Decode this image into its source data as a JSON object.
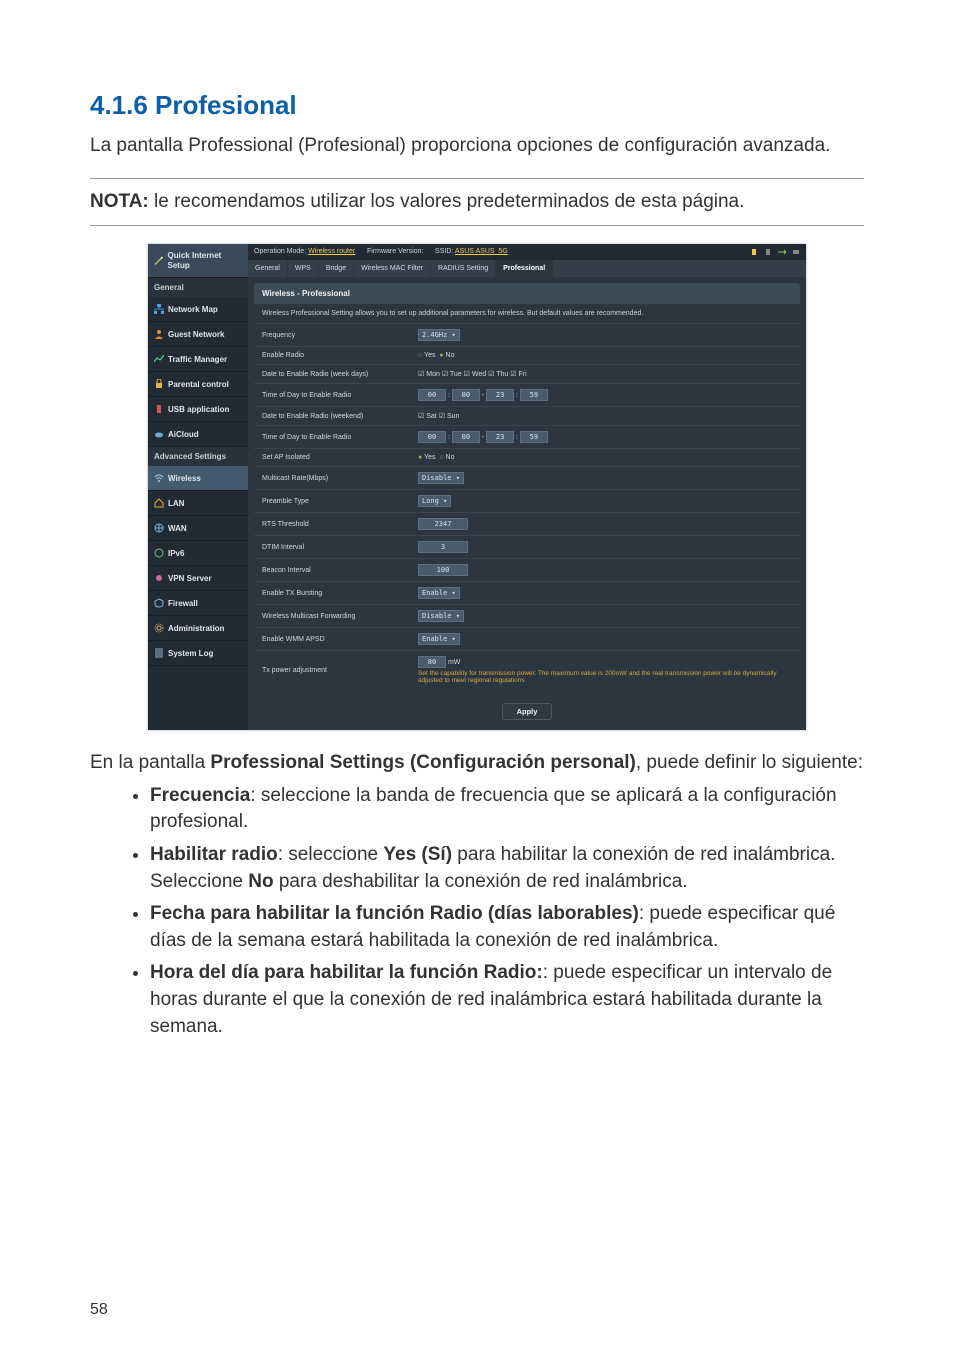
{
  "heading": "4.1.6 Profesional",
  "intro": "La pantalla Professional (Profesional) proporciona opciones de configuración avanzada.",
  "note_label": "NOTA:",
  "note_text": "  le recomendamos utilizar los valores predeterminados de esta página.",
  "bottom_intro_strong": "Professional Settings (Configuración personal)",
  "bottom_intro_prefix": "En la pantalla ",
  "bottom_intro_suffix": ", puede definir lo siguiente:",
  "bullets": [
    {
      "bold": "Frecuencia",
      "rest": ":  seleccione la banda de frecuencia que se aplicará a la configuración profesional."
    },
    {
      "bold": "Habilitar radio",
      "rest": ":  seleccione ",
      "bold2": "Yes (Sí)",
      "mid": " para habilitar la conexión de red inalámbrica. Seleccione ",
      "bold3": "No",
      "tail": " para deshabilitar la conexión de red inalámbrica."
    },
    {
      "bold": "Fecha para habilitar la función Radio (días laborables)",
      "rest": ":  puede especificar qué días de la semana estará habilitada la conexión de red inalámbrica."
    },
    {
      "bold": "Hora del día para habilitar la función Radio:",
      "rest": ":  puede especificar un intervalo de horas durante el que la conexión de red inalámbrica estará habilitada durante la semana."
    }
  ],
  "page_number": "58",
  "router": {
    "top_mode_label": "Operation Mode:",
    "top_mode_value": "Wireless router",
    "top_fw_label": "Firmware Version:",
    "top_ssid_label": "SSID:",
    "top_ssid_values": "ASUS ASUS_5G",
    "sidebar": {
      "quick": "Quick Internet Setup",
      "section_general": "General",
      "items_general": [
        "Network Map",
        "Guest Network",
        "Traffic Manager",
        "Parental control",
        "USB application",
        "AiCloud"
      ],
      "section_advanced": "Advanced Settings",
      "items_advanced": [
        "Wireless",
        "LAN",
        "WAN",
        "IPv6",
        "VPN Server",
        "Firewall",
        "Administration",
        "System Log"
      ]
    },
    "tabs": [
      "General",
      "WPS",
      "Bridge",
      "Wireless MAC Filter",
      "RADIUS Setting",
      "Professional"
    ],
    "panel_title": "Wireless - Professional",
    "panel_desc": "Wireless Professional Setting allows you to set up additional parameters for wireless. But default values are recommended.",
    "rows": {
      "frequency": {
        "label": "Frequency",
        "value": "2.4GHz"
      },
      "enable_radio": {
        "label": "Enable Radio",
        "yes": "Yes",
        "no": "No"
      },
      "date_week": {
        "label": "Date to Enable Radio (week days)",
        "days": [
          "Mon",
          "Tue",
          "Wed",
          "Thu",
          "Fri"
        ]
      },
      "time_week": {
        "label": "Time of Day to Enable Radio",
        "h1": "00",
        "m1": "00",
        "h2": "23",
        "m2": "59"
      },
      "date_wkend": {
        "label": "Date to Enable Radio (weekend)",
        "days": [
          "Sat",
          "Sun"
        ]
      },
      "time_wkend": {
        "label": "Time of Day to Enable Radio",
        "h1": "00",
        "m1": "00",
        "h2": "23",
        "m2": "59"
      },
      "ap_isolated": {
        "label": "Set AP Isolated",
        "yes": "Yes",
        "no": "No"
      },
      "multicast": {
        "label": "Multicast Rate(Mbps)",
        "value": "Disable"
      },
      "preamble": {
        "label": "Preamble Type",
        "value": "Long"
      },
      "rts": {
        "label": "RTS Threshold",
        "value": "2347"
      },
      "dtim": {
        "label": "DTIM Interval",
        "value": "3"
      },
      "beacon": {
        "label": "Beacon Interval",
        "value": "100"
      },
      "txburst": {
        "label": "Enable TX Bursting",
        "value": "Enable"
      },
      "wmf": {
        "label": "Wireless Multicast Forwarding",
        "value": "Disable"
      },
      "wmm": {
        "label": "Enable WMM APSD",
        "value": "Enable"
      },
      "txpower": {
        "label": "Tx power adjustment",
        "value": "80",
        "unit": "mW",
        "note": "Set the capability for transmission power. The maximum value is 200mW and the real transmission power will be dynamically adjusted to meet regional regulations"
      }
    },
    "apply": "Apply"
  }
}
